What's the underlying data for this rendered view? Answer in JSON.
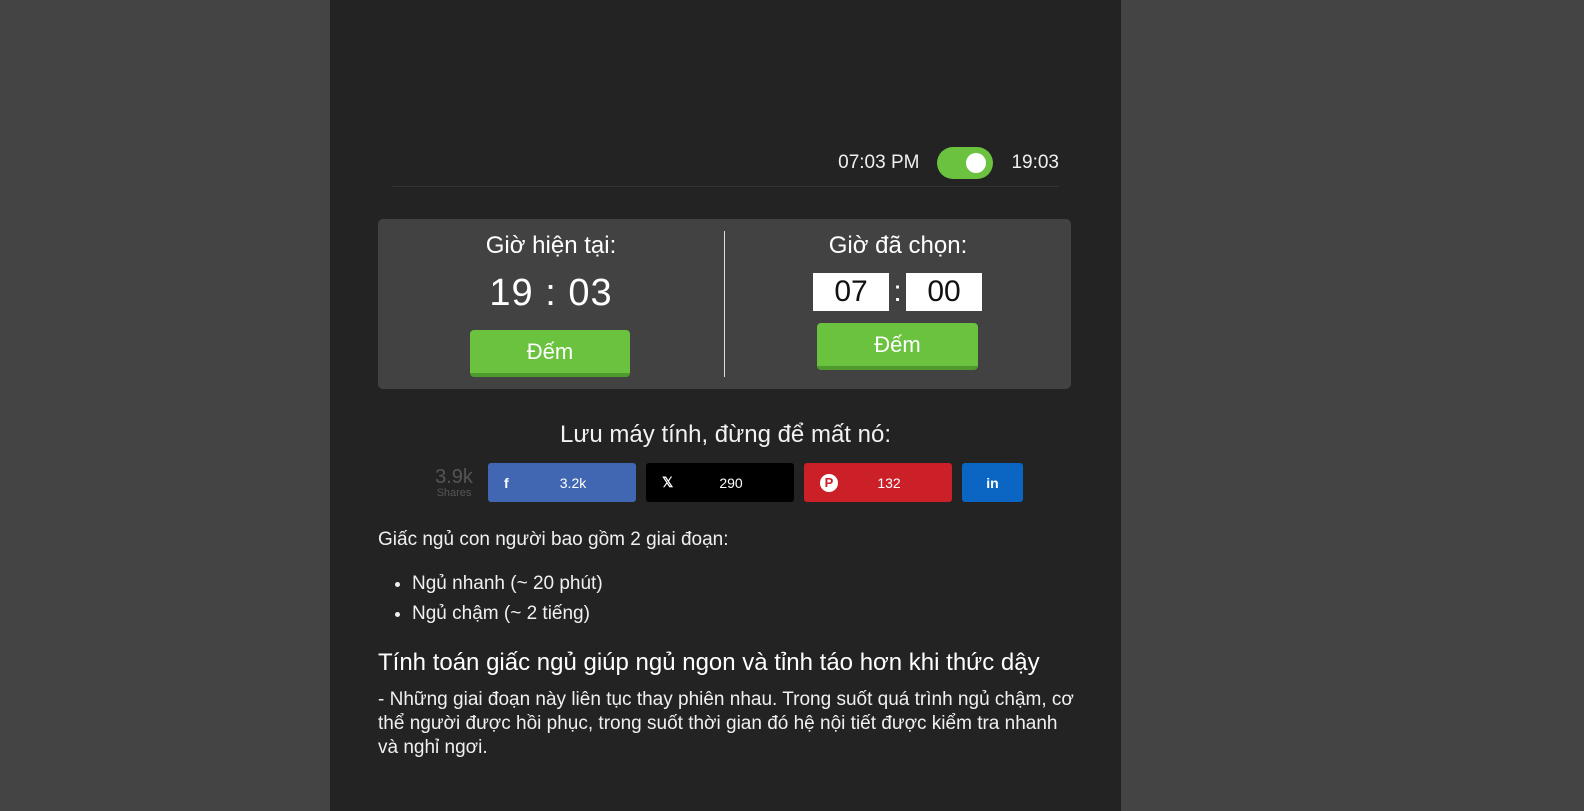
{
  "format_toggle": {
    "label_12h": "07:03 PM",
    "label_24h": "19:03",
    "enabled": true
  },
  "clock": {
    "current_title": "Giờ hiện tại:",
    "current_time": "19 : 03",
    "current_button": "Đếm",
    "chosen_title": "Giờ đã chọn:",
    "chosen_hour": "07",
    "chosen_separator": ":",
    "chosen_minute": "00",
    "chosen_button": "Đếm"
  },
  "share": {
    "title": "Lưu máy tính, đừng để mất nó:",
    "total_count": "3.9k",
    "total_label": "Shares",
    "facebook": {
      "icon": "facebook-icon",
      "glyph": "f",
      "count": "3.2k",
      "color": "#4267b2"
    },
    "x": {
      "icon": "x-icon",
      "glyph": "𝕏",
      "count": "290",
      "color": "#000000"
    },
    "pinterest": {
      "icon": "pinterest-icon",
      "glyph": "P",
      "count": "132",
      "color": "#cb2027"
    },
    "linkedin": {
      "icon": "linkedin-icon",
      "glyph": "in",
      "color": "#0a66c2"
    }
  },
  "content": {
    "intro": "Giấc ngủ con người bao gồm 2 giai đoạn:",
    "stages": [
      "Ngủ nhanh (~ 20 phút)",
      "Ngủ chậm (~ 2 tiếng)"
    ],
    "heading": "Tính toán giấc ngủ giúp ngủ ngon và tỉnh táo hơn khi thức dậy",
    "paragraph": "- Những giai đoạn này liên tục thay phiên nhau. Trong suốt quá trình ngủ chậm, cơ thể người được hồi phục, trong suốt thời gian đó hệ nội tiết được kiểm tra nhanh và nghỉ ngơi."
  },
  "colors": {
    "accent": "#6ac23f",
    "page_bg": "#232323",
    "outer_bg": "#444444",
    "panel_bg": "#424242"
  }
}
